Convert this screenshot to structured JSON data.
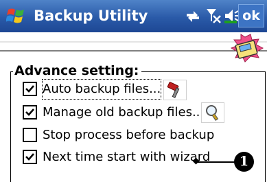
{
  "titlebar": {
    "title": "Backup Utility",
    "ok_label": "ok",
    "icons": [
      "windows-start-icon",
      "connectivity-icon",
      "signal-off-icon",
      "volume-icon"
    ]
  },
  "group": {
    "title": "Advance setting:"
  },
  "options": [
    {
      "label": "Auto backup files...",
      "checked": true,
      "focused": true,
      "icon": "hammer-tool-icon"
    },
    {
      "label": "Manage old backup files...",
      "checked": true,
      "focused": false,
      "icon": "magnifier-tool-icon"
    },
    {
      "label": "Stop process before backup",
      "checked": false,
      "focused": false
    },
    {
      "label": "Next time start with wizard",
      "checked": true,
      "focused": false
    }
  ],
  "callout": {
    "number": "1"
  },
  "colors": {
    "titlebar": "#2a5aa8",
    "text": "#000000",
    "accent_green": "#1ea01e"
  }
}
